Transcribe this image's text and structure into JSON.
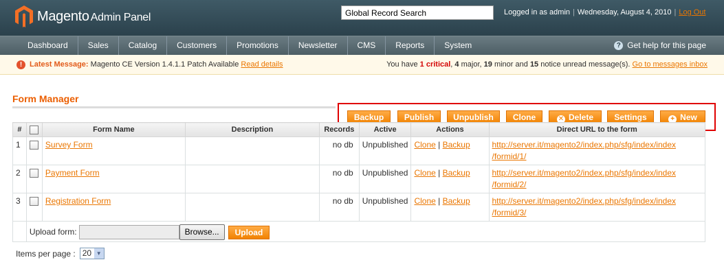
{
  "header": {
    "logo_text": "Magento",
    "logo_sub": "Admin Panel",
    "search_value": "Global Record Search",
    "logged_in": "Logged in as admin",
    "date": "Wednesday, August 4, 2010",
    "logout": "Log Out"
  },
  "nav": {
    "items": [
      "Dashboard",
      "Sales",
      "Catalog",
      "Customers",
      "Promotions",
      "Newsletter",
      "CMS",
      "Reports",
      "System"
    ],
    "help": "Get help for this page"
  },
  "message": {
    "label": "Latest Message:",
    "text": "Magento CE Version 1.4.1.1 Patch Available",
    "link": "Read details",
    "you_have": "You have",
    "critical_count": "1",
    "critical_label": "critical",
    "major_count": "4",
    "major_label": "major",
    "minor_count": "19",
    "minor_label": "minor and",
    "notice_count": "15",
    "notice_label": "notice unread message(s).",
    "go_link": "Go to messages inbox"
  },
  "page": {
    "title": "Form Manager"
  },
  "toolbar": {
    "backup": "Backup",
    "publish": "Publish",
    "unpublish": "Unpublish",
    "clone": "Clone",
    "delete": "Delete",
    "settings": "Settings",
    "new": "New"
  },
  "grid": {
    "columns": [
      "#",
      "",
      "Form Name",
      "Description",
      "Records",
      "Active",
      "Actions",
      "Direct URL to the form"
    ],
    "rows": [
      {
        "num": "1",
        "name": "Survey Form",
        "description": "",
        "records": "no db",
        "active": "Unpublished",
        "action_clone": "Clone",
        "action_sep": "|",
        "action_backup": "Backup",
        "url_line1": "http://server.it/magento2/index.php/sfg/index/index",
        "url_line2": "/formid/1/"
      },
      {
        "num": "2",
        "name": "Payment Form",
        "description": "",
        "records": "no db",
        "active": "Unpublished",
        "action_clone": "Clone",
        "action_sep": "|",
        "action_backup": "Backup",
        "url_line1": "http://server.it/magento2/index.php/sfg/index/index",
        "url_line2": "/formid/2/"
      },
      {
        "num": "3",
        "name": "Registration Form",
        "description": "",
        "records": "no db",
        "active": "Unpublished",
        "action_clone": "Clone",
        "action_sep": "|",
        "action_backup": "Backup",
        "url_line1": "http://server.it/magento2/index.php/sfg/index/index",
        "url_line2": "/formid/3/"
      }
    ],
    "upload_label": "Upload form:",
    "browse": "Browse...",
    "upload": "Upload"
  },
  "pager": {
    "label": "Items per page :",
    "value": "20"
  },
  "colors": {
    "accent": "#eb5e00",
    "button": "#f18200",
    "header": "#2b414c",
    "highlight_frame": "#e00000"
  }
}
